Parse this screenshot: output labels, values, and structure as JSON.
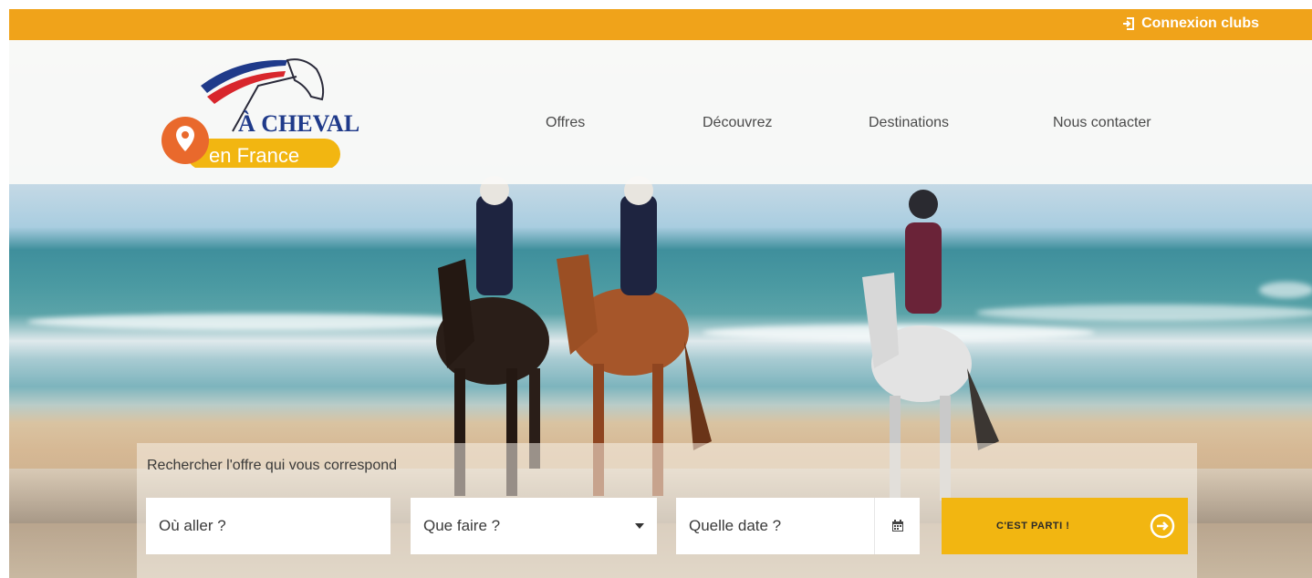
{
  "topbar": {
    "login_label": "Connexion clubs",
    "color": "#f0a31a"
  },
  "brand": {
    "line1": "À CHEVAL",
    "line2": "en France"
  },
  "nav": {
    "items": [
      {
        "label": "Offres"
      },
      {
        "label": "Découvrez"
      },
      {
        "label": "Destinations"
      },
      {
        "label": "Nous contacter"
      }
    ]
  },
  "search": {
    "title": "Rechercher l'offre qui vous correspond",
    "where_placeholder": "Où aller ?",
    "what_placeholder": "Que faire ?",
    "when_placeholder": "Quelle date ?",
    "submit_label": "C'EST PARTI !"
  },
  "colors": {
    "accent": "#f2b611",
    "brand_orange": "#f0a31a",
    "pin_orange": "#e9692c",
    "navy": "#1f3a8a",
    "red": "#d8262c"
  }
}
